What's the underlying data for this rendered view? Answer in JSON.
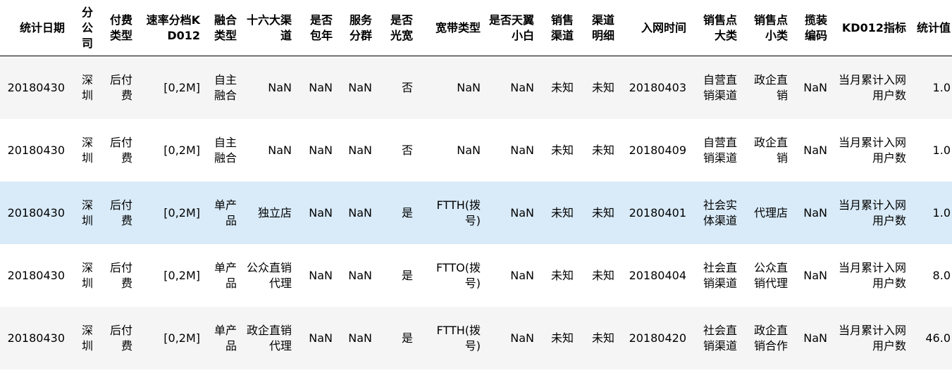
{
  "table": {
    "columns": [
      "统计日期",
      "分公司",
      "付费类型",
      "速率分档KD012",
      "融合类型",
      "十六大渠道",
      "是否包年",
      "服务分群",
      "是否光宽",
      "宽带类型",
      "是否天翼小白",
      "销售渠道",
      "渠道明细",
      "入网时间",
      "销售点大类",
      "销售点小类",
      "揽装编码",
      "KD012指标",
      "统计值"
    ],
    "rows": [
      [
        "20180430",
        "深圳",
        "后付费",
        "[0,2M]",
        "自主融合",
        "NaN",
        "NaN",
        "NaN",
        "否",
        "NaN",
        "NaN",
        "未知",
        "未知",
        "20180403",
        "自营直销渠道",
        "政企直销",
        "NaN",
        "当月累计入网用户数",
        "1.0"
      ],
      [
        "20180430",
        "深圳",
        "后付费",
        "[0,2M]",
        "自主融合",
        "NaN",
        "NaN",
        "NaN",
        "否",
        "NaN",
        "NaN",
        "未知",
        "未知",
        "20180409",
        "自营直销渠道",
        "政企直销",
        "NaN",
        "当月累计入网用户数",
        "1.0"
      ],
      [
        "20180430",
        "深圳",
        "后付费",
        "[0,2M]",
        "单产品",
        "独立店",
        "NaN",
        "NaN",
        "是",
        "FTTH(拨号)",
        "NaN",
        "未知",
        "未知",
        "20180401",
        "社会实体渠道",
        "代理店",
        "NaN",
        "当月累计入网用户数",
        "1.0"
      ],
      [
        "20180430",
        "深圳",
        "后付费",
        "[0,2M]",
        "单产品",
        "公众直销代理",
        "NaN",
        "NaN",
        "是",
        "FTTO(拨号)",
        "NaN",
        "未知",
        "未知",
        "20180404",
        "社会直销渠道",
        "公众直销代理",
        "NaN",
        "当月累计入网用户数",
        "8.0"
      ],
      [
        "20180430",
        "深圳",
        "后付费",
        "[0,2M]",
        "单产品",
        "政企直销代理",
        "NaN",
        "NaN",
        "是",
        "FTTH(拨号)",
        "NaN",
        "未知",
        "未知",
        "20180420",
        "社会直销渠道",
        "政企直销合作",
        "NaN",
        "当月累计入网用户数",
        "46.0"
      ]
    ],
    "hover_row": 2,
    "colors": {
      "row_odd": "#f5f5f5",
      "row_even": "#ffffff",
      "row_hover": "#d9ebf9",
      "header_border": "#000000"
    }
  }
}
